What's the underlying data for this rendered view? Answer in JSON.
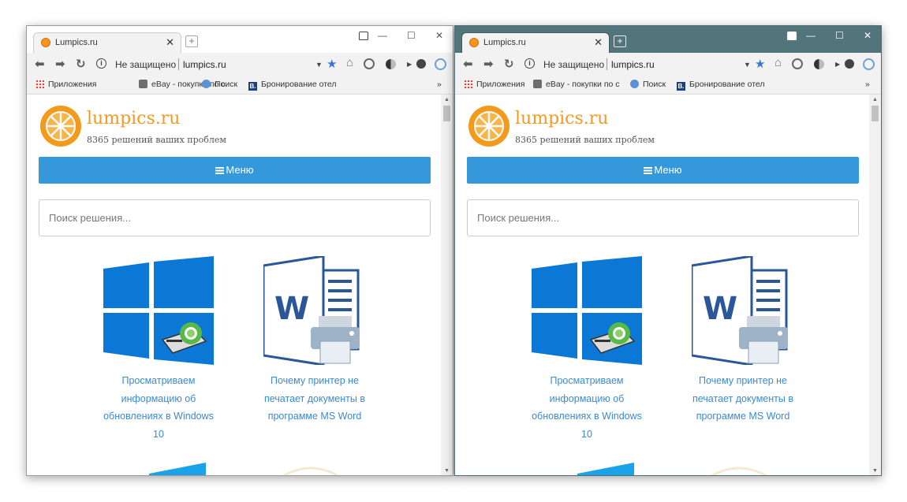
{
  "windows": [
    {
      "tab_title": "Lumpics.ru",
      "address": {
        "security_text": "Не защищено",
        "url": "lumpics.ru"
      },
      "bookmarks": [
        {
          "label": "Приложения",
          "icon": "apps-grid-icon"
        },
        {
          "label": "eBay - покупки по с",
          "icon": "ebay-bag-icon"
        },
        {
          "label": "Поиск",
          "icon": "globe-icon"
        },
        {
          "label": "Бронирование отел",
          "icon": "booking-icon"
        }
      ],
      "bookmarks_more": "»",
      "site": {
        "name": "lumpics.ru",
        "tagline": "8365 решений ваших проблем",
        "menu_label": "Меню",
        "search_placeholder": "Поиск решения...",
        "articles": [
          {
            "title": "Просматриваем информацию об обновлениях в Windows 10"
          },
          {
            "title": "Почему принтер не печатает документы в программе MS Word"
          }
        ]
      }
    },
    {
      "tab_title": "Lumpics.ru",
      "address": {
        "security_text": "Не защищено",
        "url": "lumpics.ru"
      },
      "bookmarks": [
        {
          "label": "Приложения",
          "icon": "apps-grid-icon"
        },
        {
          "label": "eBay - покупки по с",
          "icon": "ebay-bag-icon"
        },
        {
          "label": "Поиск",
          "icon": "globe-icon"
        },
        {
          "label": "Бронирование отел",
          "icon": "booking-icon"
        }
      ],
      "bookmarks_more": "»",
      "site": {
        "name": "lumpics.ru",
        "tagline": "8365 решений ваших проблем",
        "menu_label": "Меню",
        "search_placeholder": "Поиск решения...",
        "articles": [
          {
            "title": "Просматриваем информацию об обновлениях в Windows 10"
          },
          {
            "title": "Почему принтер не печатает документы в программе MS Word"
          }
        ]
      }
    }
  ],
  "colors": {
    "accent_blue": "#3498db",
    "brand_orange": "#f39a1e",
    "link_blue": "#3b8ad0",
    "themed_titlebar": "#52747b"
  }
}
